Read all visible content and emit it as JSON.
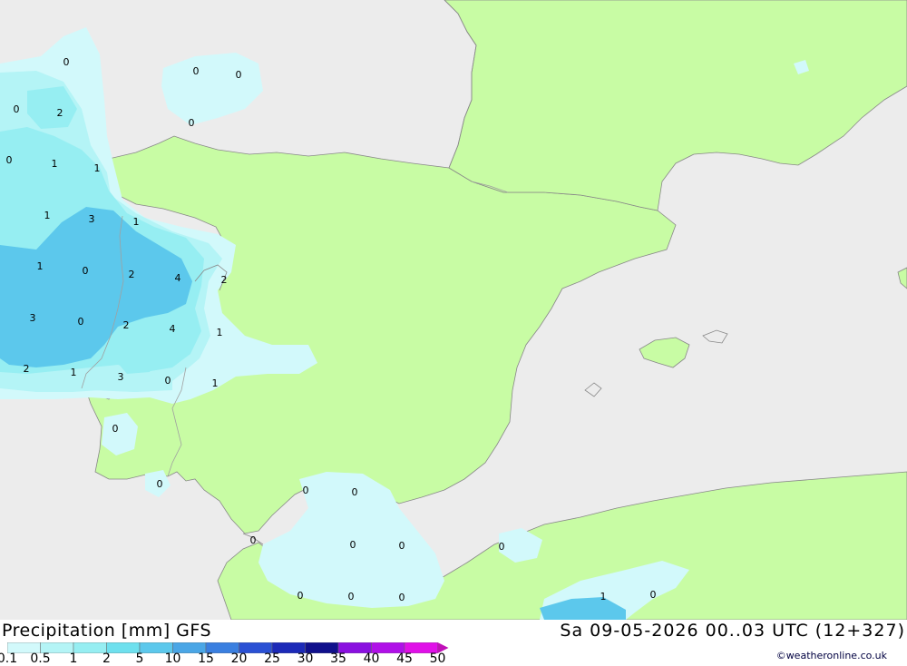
{
  "header": {
    "title": "Precipitation [mm] GFS",
    "datetime": "Sa 09-05-2026 00..03 UTC (12+327)",
    "credit": "©weatheronline.co.uk"
  },
  "legend": {
    "levels": [
      "0.1",
      "0.5",
      "1",
      "2",
      "5",
      "10",
      "15",
      "20",
      "25",
      "30",
      "35",
      "40",
      "45",
      "50"
    ],
    "colors": [
      "#d2f9fb",
      "#b4f4f6",
      "#96eef2",
      "#6ee0ee",
      "#5cc8ec",
      "#4aa6e6",
      "#3a7fe0",
      "#2a50d4",
      "#1c2ab8",
      "#10108c",
      "#8a10e0",
      "#b010e8",
      "#e010e8",
      "#c010b8"
    ]
  },
  "map": {
    "colors": {
      "sea": "#ececec",
      "land": "#c8fca4",
      "border": "#a0a0a0",
      "coast": "#888888"
    },
    "values": [
      "0",
      "0",
      "0",
      "0",
      "2",
      "0",
      "0",
      "1",
      "1",
      "1",
      "1",
      "3",
      "1",
      "0",
      "2",
      "4",
      "3",
      "0",
      "2",
      "4",
      "1",
      "2",
      "1",
      "3",
      "2",
      "0",
      "1",
      "0",
      "0",
      "0",
      "0",
      "0",
      "0",
      "0",
      "0",
      "0",
      "0",
      "0",
      "1",
      "0"
    ]
  }
}
